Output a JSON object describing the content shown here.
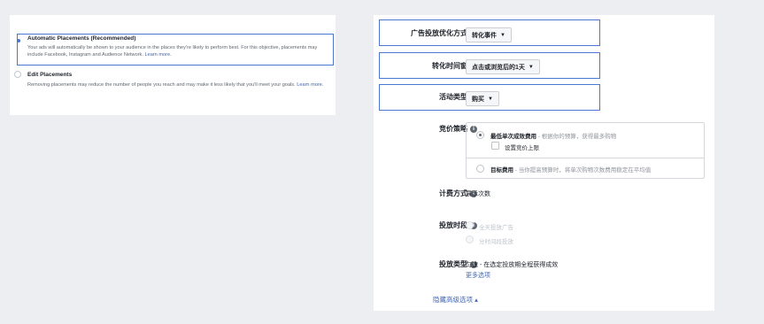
{
  "placements": {
    "automatic": {
      "title": "Automatic Placements (Recommended)",
      "description": "Your ads will automatically be shown to your audience in the places they're likely to perform best. For this objective, placements may include Facebook, Instagram and Audience Network.",
      "link": "Learn more."
    },
    "edit": {
      "title": "Edit Placements",
      "description": "Removing placements may reduce the number of people you reach and may make it less likely that you'll meet your goals.",
      "link": "Learn more."
    }
  },
  "settings": {
    "optimization": {
      "label": "广告投放优化方式",
      "value": "转化事件"
    },
    "conversion_window": {
      "label": "转化时间窗",
      "value": "点击或浏览后的1天"
    },
    "event_type": {
      "label": "活动类型",
      "value": "购买"
    },
    "bid_strategy": {
      "label": "竞价策略",
      "option1_title": "最低单次成效费用",
      "option1_desc": "- 根据你的预算，获得最多购物",
      "cap_checkbox": "设置竞价上限",
      "option2_title": "目标费用",
      "option2_desc": "- 当你提高预算时，将单次购物次数费用稳定在平均值"
    },
    "billing": {
      "label": "计费方式",
      "value": "展示次数"
    },
    "schedule": {
      "label": "投放时段",
      "option1": "全天投放广告",
      "option2": "分时间段投放"
    },
    "delivery_type": {
      "label": "投放类型",
      "value": "匀速 - 在选定投放期全程获得成效",
      "more": "更多选项"
    },
    "hide_advanced": "隐藏高级选项 ▴"
  },
  "icons": {
    "info": "info-icon",
    "caret": "caret-down-icon"
  },
  "colors": {
    "highlight": "#4a78d0",
    "link": "#4267b2",
    "background": "#eceef2"
  }
}
